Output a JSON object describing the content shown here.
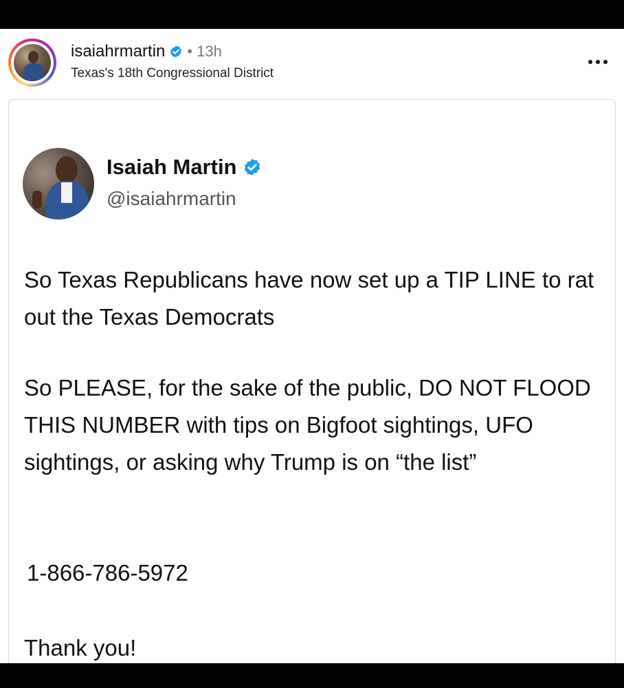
{
  "post": {
    "username": "isaiahrmartin",
    "separator": "•",
    "time_ago": "13h",
    "location": "Texas's 18th Congressional District",
    "more_label": "..."
  },
  "tweet": {
    "display_name": "Isaiah Martin",
    "handle": "@isaiahrmartin",
    "paragraphs": [
      "So Texas Republicans have now set up a TIP LINE to rat out the Texas Democrats",
      "So PLEASE, for the sake of the public, DO NOT FLOOD THIS NUMBER with tips on Bigfoot sightings, UFO sightings, or asking why Trump is on “the list”",
      "1-866-786-5972",
      "Thank you!"
    ]
  },
  "icons": {
    "verified": "verified-badge-icon",
    "more": "more-options-icon"
  },
  "colors": {
    "verified_blue": "#1d9bf0",
    "story_ring": [
      "#feda75",
      "#fa7e1e",
      "#d62976",
      "#962fbf",
      "#4f5bd5"
    ]
  }
}
